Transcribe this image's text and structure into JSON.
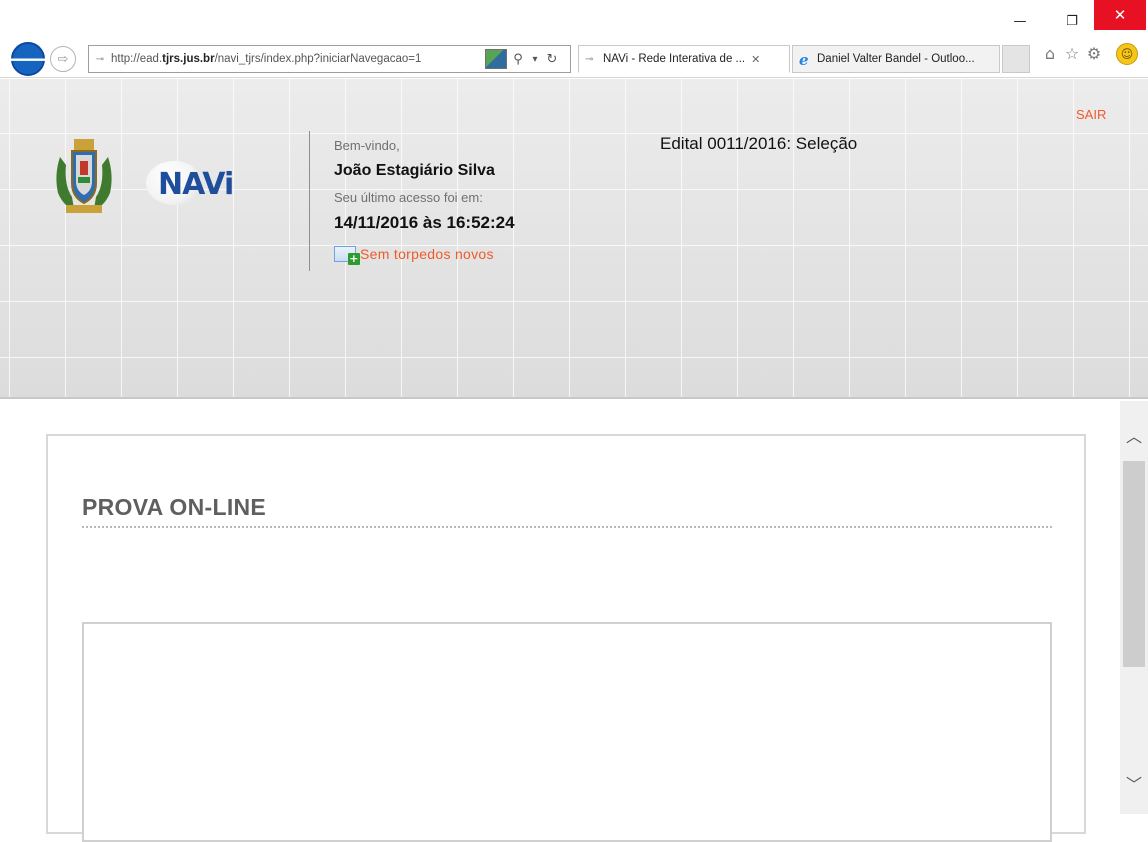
{
  "window": {
    "minimize_glyph": "—",
    "restore_glyph": "❐",
    "close_glyph": "✕"
  },
  "browser": {
    "back_icon": "back-arrow-icon",
    "back_glyph": "🡐",
    "forward_glyph": "⇨",
    "address": {
      "favicon_glyph": "⊸",
      "url_prefix": "http://ead.",
      "url_domain": "tjrs.jus.br",
      "url_path": "/navi_tjrs/index.php?iniciarNavegacao=1",
      "search_glyph": "⚲",
      "dropdown_glyph": "▾",
      "refresh_glyph": "↻"
    },
    "tabs": [
      {
        "favicon_glyph": "⊸",
        "label": "NAVi - Rede Interativa de ...",
        "close_glyph": "✕"
      },
      {
        "favicon_glyph": "e",
        "label": "Daniel Valter Bandel - Outloo..."
      }
    ],
    "tools": {
      "home_glyph": "⌂",
      "star_glyph": "☆",
      "gear_glyph": "⚙",
      "smiley_glyph": "☺"
    }
  },
  "header": {
    "exit_label": "SAIR",
    "logo_text": "NAVi",
    "welcome_label": "Bem-vindo,",
    "user_name": "João Estagiário Silva",
    "last_access_label": "Seu último acesso foi em:",
    "last_access_value": "14/11/2016 às 16:52:24",
    "messages_label": "Sem torpedos novos",
    "notice_title": "Edital 0011/2016: Seleção"
  },
  "content": {
    "exam_title": "PROVA ON-LINE"
  },
  "scrollbar": {
    "up_glyph": "︿",
    "down_glyph": "﹀"
  },
  "colors": {
    "accent_orange": "#f05a28",
    "close_red": "#e81123",
    "back_blue": "#1565c0",
    "logo_blue": "#1f4e9c"
  }
}
